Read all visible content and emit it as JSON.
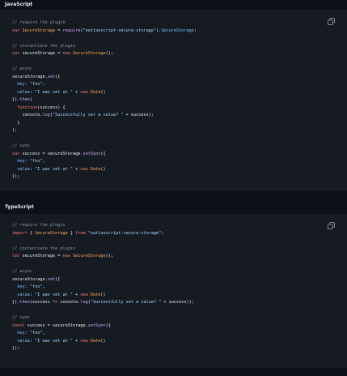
{
  "sections": {
    "js": {
      "title": "JavaScript"
    },
    "ts": {
      "title": "TypeScript"
    }
  },
  "copy_icon": "copy-icon",
  "colors": {
    "background": "#0d1117",
    "code_background": "#161b22",
    "comment": "#8b949e",
    "keyword": "#ff7b72",
    "function": "#d2a8ff",
    "string": "#a5d6ff",
    "property": "#79c0ff",
    "entity": "#ffa657"
  },
  "js_lines": [
    [
      [
        "c",
        "// require the plugin"
      ]
    ],
    [
      [
        "k",
        "var "
      ],
      [
        "e",
        "SecureStorage"
      ],
      [
        "p",
        " = "
      ],
      [
        "f",
        "require"
      ],
      [
        "p",
        "("
      ],
      [
        "s",
        "\"nativescript-secure-storage\""
      ],
      [
        "p",
        ")."
      ],
      [
        "v",
        "SecureStorage"
      ],
      [
        "p",
        ";"
      ]
    ],
    [],
    [
      [
        "c",
        "// instantiate the plugin"
      ]
    ],
    [
      [
        "k",
        "var "
      ],
      [
        "p",
        "secureStorage = "
      ],
      [
        "k",
        "new "
      ],
      [
        "e",
        "SecureStorage"
      ],
      [
        "p",
        "();"
      ]
    ],
    [],
    [
      [
        "c",
        "// async"
      ]
    ],
    [
      [
        "p",
        "secureStorage."
      ],
      [
        "f",
        "set"
      ],
      [
        "p",
        "({"
      ]
    ],
    [
      [
        "v",
        "  key"
      ],
      [
        "p",
        ": "
      ],
      [
        "s",
        "\"foo\""
      ],
      [
        "p",
        ","
      ]
    ],
    [
      [
        "v",
        "  value"
      ],
      [
        "p",
        ": "
      ],
      [
        "s",
        "\"I was set at \""
      ],
      [
        "p",
        " + "
      ],
      [
        "k",
        "new "
      ],
      [
        "e",
        "Date"
      ],
      [
        "p",
        "()"
      ]
    ],
    [
      [
        "p",
        "})."
      ],
      [
        "f",
        "then"
      ],
      [
        "p",
        "("
      ]
    ],
    [
      [
        "k",
        "  function"
      ],
      [
        "p",
        "(success) {"
      ]
    ],
    [
      [
        "p",
        "    console."
      ],
      [
        "f",
        "log"
      ],
      [
        "p",
        "("
      ],
      [
        "s",
        "\"Successfully set a value? \""
      ],
      [
        "p",
        " + success);"
      ]
    ],
    [
      [
        "p",
        "  }"
      ]
    ],
    [
      [
        "p",
        ");"
      ]
    ],
    [],
    [
      [
        "c",
        "// sync"
      ]
    ],
    [
      [
        "k",
        "var "
      ],
      [
        "p",
        "success = secureStorage."
      ],
      [
        "f",
        "setSync"
      ],
      [
        "p",
        "({"
      ]
    ],
    [
      [
        "v",
        "  key"
      ],
      [
        "p",
        ": "
      ],
      [
        "s",
        "\"foo\""
      ],
      [
        "p",
        ","
      ]
    ],
    [
      [
        "v",
        "  value"
      ],
      [
        "p",
        ": "
      ],
      [
        "s",
        "\"I was set at \""
      ],
      [
        "p",
        " + "
      ],
      [
        "k",
        "new "
      ],
      [
        "e",
        "Date"
      ],
      [
        "p",
        "()"
      ]
    ],
    [
      [
        "p",
        "});"
      ]
    ]
  ],
  "ts_lines": [
    [
      [
        "c",
        "// require the plugin"
      ]
    ],
    [
      [
        "k",
        "import "
      ],
      [
        "p",
        "{ "
      ],
      [
        "e",
        "SecureStorage"
      ],
      [
        "p",
        " } "
      ],
      [
        "k",
        "from "
      ],
      [
        "s",
        "\"nativescript-secure-storage\""
      ],
      [
        "p",
        ";"
      ]
    ],
    [],
    [
      [
        "c",
        "// instantiate the plugin"
      ]
    ],
    [
      [
        "k",
        "let "
      ],
      [
        "p",
        "secureStorage = "
      ],
      [
        "k",
        "new "
      ],
      [
        "e",
        "SecureStorage"
      ],
      [
        "p",
        "();"
      ]
    ],
    [],
    [
      [
        "c",
        "// async"
      ]
    ],
    [
      [
        "p",
        "secureStorage."
      ],
      [
        "f",
        "set"
      ],
      [
        "p",
        "({"
      ]
    ],
    [
      [
        "v",
        "  key"
      ],
      [
        "p",
        ": "
      ],
      [
        "s",
        "\"foo\""
      ],
      [
        "p",
        ","
      ]
    ],
    [
      [
        "v",
        "  value"
      ],
      [
        "p",
        ": "
      ],
      [
        "s",
        "\"I was set at \""
      ],
      [
        "p",
        " + "
      ],
      [
        "k",
        "new "
      ],
      [
        "e",
        "Date"
      ],
      [
        "p",
        "()"
      ]
    ],
    [
      [
        "p",
        "})."
      ],
      [
        "f",
        "then"
      ],
      [
        "p",
        "(success "
      ],
      [
        "k",
        "=> "
      ],
      [
        "p",
        "console."
      ],
      [
        "f",
        "log"
      ],
      [
        "p",
        "("
      ],
      [
        "s",
        "\"Successfully set a value? \""
      ],
      [
        "p",
        " + success));"
      ]
    ],
    [],
    [
      [
        "c",
        "// sync"
      ]
    ],
    [
      [
        "k",
        "const "
      ],
      [
        "p",
        "success = secureStorage."
      ],
      [
        "f",
        "setSync"
      ],
      [
        "p",
        "({"
      ]
    ],
    [
      [
        "v",
        "  key"
      ],
      [
        "p",
        ": "
      ],
      [
        "s",
        "\"foo\""
      ],
      [
        "p",
        ","
      ]
    ],
    [
      [
        "v",
        "  value"
      ],
      [
        "p",
        ": "
      ],
      [
        "s",
        "\"I was set at \""
      ],
      [
        "p",
        " + "
      ],
      [
        "k",
        "new "
      ],
      [
        "e",
        "Date"
      ],
      [
        "p",
        "()"
      ]
    ],
    [
      [
        "p",
        "});"
      ]
    ]
  ]
}
